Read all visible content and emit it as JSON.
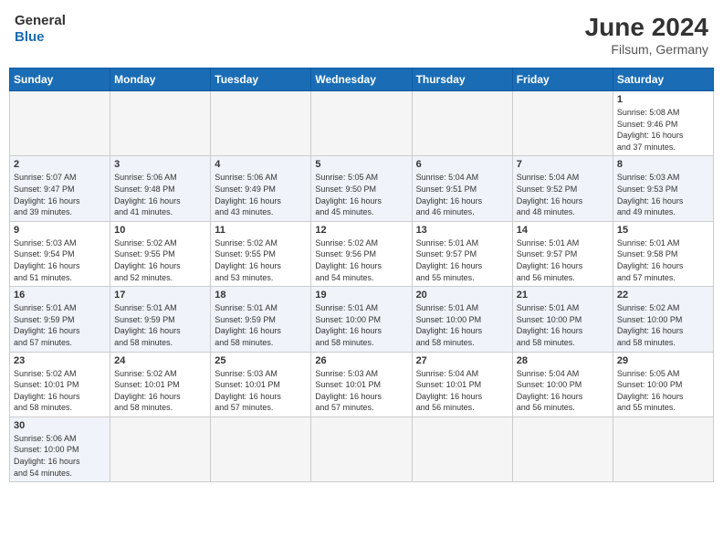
{
  "header": {
    "logo_general": "General",
    "logo_blue": "Blue",
    "month_year": "June 2024",
    "location": "Filsum, Germany"
  },
  "days_of_week": [
    "Sunday",
    "Monday",
    "Tuesday",
    "Wednesday",
    "Thursday",
    "Friday",
    "Saturday"
  ],
  "weeks": [
    [
      {
        "day": "",
        "empty": true
      },
      {
        "day": "",
        "empty": true
      },
      {
        "day": "",
        "empty": true
      },
      {
        "day": "",
        "empty": true
      },
      {
        "day": "",
        "empty": true
      },
      {
        "day": "",
        "empty": true
      },
      {
        "day": "1",
        "sunrise": "Sunrise: 5:08 AM",
        "sunset": "Sunset: 9:46 PM",
        "daylight": "Daylight: 16 hours and 37 minutes."
      }
    ],
    [
      {
        "day": "2",
        "sunrise": "Sunrise: 5:07 AM",
        "sunset": "Sunset: 9:47 PM",
        "daylight": "Daylight: 16 hours and 39 minutes."
      },
      {
        "day": "3",
        "sunrise": "Sunrise: 5:06 AM",
        "sunset": "Sunset: 9:48 PM",
        "daylight": "Daylight: 16 hours and 41 minutes."
      },
      {
        "day": "4",
        "sunrise": "Sunrise: 5:06 AM",
        "sunset": "Sunset: 9:49 PM",
        "daylight": "Daylight: 16 hours and 43 minutes."
      },
      {
        "day": "5",
        "sunrise": "Sunrise: 5:05 AM",
        "sunset": "Sunset: 9:50 PM",
        "daylight": "Daylight: 16 hours and 45 minutes."
      },
      {
        "day": "6",
        "sunrise": "Sunrise: 5:04 AM",
        "sunset": "Sunset: 9:51 PM",
        "daylight": "Daylight: 16 hours and 46 minutes."
      },
      {
        "day": "7",
        "sunrise": "Sunrise: 5:04 AM",
        "sunset": "Sunset: 9:52 PM",
        "daylight": "Daylight: 16 hours and 48 minutes."
      },
      {
        "day": "8",
        "sunrise": "Sunrise: 5:03 AM",
        "sunset": "Sunset: 9:53 PM",
        "daylight": "Daylight: 16 hours and 49 minutes."
      }
    ],
    [
      {
        "day": "9",
        "sunrise": "Sunrise: 5:03 AM",
        "sunset": "Sunset: 9:54 PM",
        "daylight": "Daylight: 16 hours and 51 minutes."
      },
      {
        "day": "10",
        "sunrise": "Sunrise: 5:02 AM",
        "sunset": "Sunset: 9:55 PM",
        "daylight": "Daylight: 16 hours and 52 minutes."
      },
      {
        "day": "11",
        "sunrise": "Sunrise: 5:02 AM",
        "sunset": "Sunset: 9:55 PM",
        "daylight": "Daylight: 16 hours and 53 minutes."
      },
      {
        "day": "12",
        "sunrise": "Sunrise: 5:02 AM",
        "sunset": "Sunset: 9:56 PM",
        "daylight": "Daylight: 16 hours and 54 minutes."
      },
      {
        "day": "13",
        "sunrise": "Sunrise: 5:01 AM",
        "sunset": "Sunset: 9:57 PM",
        "daylight": "Daylight: 16 hours and 55 minutes."
      },
      {
        "day": "14",
        "sunrise": "Sunrise: 5:01 AM",
        "sunset": "Sunset: 9:57 PM",
        "daylight": "Daylight: 16 hours and 56 minutes."
      },
      {
        "day": "15",
        "sunrise": "Sunrise: 5:01 AM",
        "sunset": "Sunset: 9:58 PM",
        "daylight": "Daylight: 16 hours and 57 minutes."
      }
    ],
    [
      {
        "day": "16",
        "sunrise": "Sunrise: 5:01 AM",
        "sunset": "Sunset: 9:59 PM",
        "daylight": "Daylight: 16 hours and 57 minutes."
      },
      {
        "day": "17",
        "sunrise": "Sunrise: 5:01 AM",
        "sunset": "Sunset: 9:59 PM",
        "daylight": "Daylight: 16 hours and 58 minutes."
      },
      {
        "day": "18",
        "sunrise": "Sunrise: 5:01 AM",
        "sunset": "Sunset: 9:59 PM",
        "daylight": "Daylight: 16 hours and 58 minutes."
      },
      {
        "day": "19",
        "sunrise": "Sunrise: 5:01 AM",
        "sunset": "Sunset: 10:00 PM",
        "daylight": "Daylight: 16 hours and 58 minutes."
      },
      {
        "day": "20",
        "sunrise": "Sunrise: 5:01 AM",
        "sunset": "Sunset: 10:00 PM",
        "daylight": "Daylight: 16 hours and 58 minutes."
      },
      {
        "day": "21",
        "sunrise": "Sunrise: 5:01 AM",
        "sunset": "Sunset: 10:00 PM",
        "daylight": "Daylight: 16 hours and 58 minutes."
      },
      {
        "day": "22",
        "sunrise": "Sunrise: 5:02 AM",
        "sunset": "Sunset: 10:00 PM",
        "daylight": "Daylight: 16 hours and 58 minutes."
      }
    ],
    [
      {
        "day": "23",
        "sunrise": "Sunrise: 5:02 AM",
        "sunset": "Sunset: 10:01 PM",
        "daylight": "Daylight: 16 hours and 58 minutes."
      },
      {
        "day": "24",
        "sunrise": "Sunrise: 5:02 AM",
        "sunset": "Sunset: 10:01 PM",
        "daylight": "Daylight: 16 hours and 58 minutes."
      },
      {
        "day": "25",
        "sunrise": "Sunrise: 5:03 AM",
        "sunset": "Sunset: 10:01 PM",
        "daylight": "Daylight: 16 hours and 57 minutes."
      },
      {
        "day": "26",
        "sunrise": "Sunrise: 5:03 AM",
        "sunset": "Sunset: 10:01 PM",
        "daylight": "Daylight: 16 hours and 57 minutes."
      },
      {
        "day": "27",
        "sunrise": "Sunrise: 5:04 AM",
        "sunset": "Sunset: 10:01 PM",
        "daylight": "Daylight: 16 hours and 56 minutes."
      },
      {
        "day": "28",
        "sunrise": "Sunrise: 5:04 AM",
        "sunset": "Sunset: 10:00 PM",
        "daylight": "Daylight: 16 hours and 56 minutes."
      },
      {
        "day": "29",
        "sunrise": "Sunrise: 5:05 AM",
        "sunset": "Sunset: 10:00 PM",
        "daylight": "Daylight: 16 hours and 55 minutes."
      }
    ],
    [
      {
        "day": "30",
        "sunrise": "Sunrise: 5:06 AM",
        "sunset": "Sunset: 10:00 PM",
        "daylight": "Daylight: 16 hours and 54 minutes."
      },
      {
        "day": "",
        "empty": true
      },
      {
        "day": "",
        "empty": true
      },
      {
        "day": "",
        "empty": true
      },
      {
        "day": "",
        "empty": true
      },
      {
        "day": "",
        "empty": true
      },
      {
        "day": "",
        "empty": true
      }
    ]
  ]
}
